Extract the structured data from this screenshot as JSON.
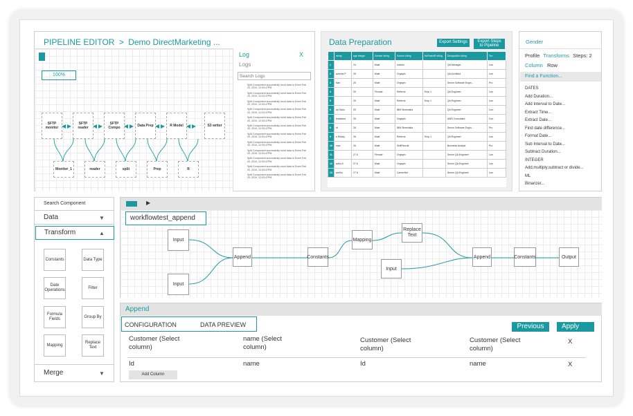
{
  "pipeline_editor": {
    "breadcrumb_root": "PIPELINE EDITOR",
    "breadcrumb_sep": ">",
    "breadcrumb_current": "Demo DirectMarketing ...",
    "zoom": "100%",
    "nodes_top": [
      "SFTP monitor",
      "SFTP reader",
      "SFTP Compo",
      "Data Prep",
      "R Model",
      "S3 writer"
    ],
    "nodes_bottom": [
      "Monitor_1",
      "reader",
      "split",
      "Prep",
      "R"
    ]
  },
  "log": {
    "title": "Log",
    "close": "X",
    "subtitle": "Logs",
    "search_placeholder": "Search Logs",
    "lines": [
      "Split Component successfully send data to Event Feb 20, 2019, 12:03:47PM",
      "Split Component successfully send data to Event Feb 20, 2019, 12:03:47PM",
      "Split Component successfully send data to Event Feb 20, 2019, 12:03:47PM",
      "Split Component successfully send data to Event Feb 20, 2019, 12:03:47PM",
      "Split Component successfully send data to Event Feb 20, 2019, 12:03:47PM",
      "Split Component successfully send data to Event Feb 20, 2019, 12:03:47PM",
      "Split Component successfully send data to Event Feb 20, 2019, 12:03:47PM",
      "Split Component successfully send data to Event Feb 20, 2019, 12:03:47PM",
      "Split Component successfully send data to Event Feb 20, 2019, 12:03:47PM",
      "Split Component successfully send data to Event Feb 20, 2019, 12:03:47PM",
      "Split Component successfully send data to Event Feb 20, 2019, 12:03:47PM",
      "Split Component successfully send data to Event Feb 20, 2019, 12:03:47PM"
    ]
  },
  "data_prep": {
    "title": "Data Preparation",
    "export_settings": "Export Settings",
    "export_steps": "Export Steps to Pipeline",
    "columns": [
      "",
      "string",
      "age integer",
      "Gender string",
      "Source string",
      "NoRatedR string",
      "Designation string",
      "Tex"
    ],
    "rows": [
      [
        "1",
        "",
        "24",
        "Male",
        "Indeed",
        "",
        "QA Manager",
        "Lan"
      ],
      [
        "2",
        "avenda P",
        "25",
        "Male",
        "Orgsyrix",
        "",
        "QA Architect",
        "Lan"
      ],
      [
        "3",
        "Nari",
        "25",
        "Male",
        "Orgsyrix",
        "",
        "Senior Software Engin...",
        "Pro"
      ],
      [
        "4",
        "",
        "25",
        "Female",
        "Referral",
        "Emp 1",
        "QA Engineer",
        "Lan"
      ],
      [
        "5",
        "",
        "25",
        "Male",
        "Referral",
        "Emp 1",
        "QA Engineer",
        "Lan"
      ],
      [
        "6",
        "an Sahu",
        "25",
        "Male",
        "IBM Simeslabs",
        "",
        "QA Engineer",
        "Con"
      ],
      [
        "7",
        "enastava",
        "25",
        "Male",
        "Orgsyrix",
        "",
        "AWS Consultant",
        "Con"
      ],
      [
        "8",
        "rit",
        "26",
        "Male",
        "IBM Simeslabs",
        "",
        "Senior Software Engin...",
        "Pro"
      ],
      [
        "9",
        "a Reddy",
        "26",
        "Male",
        "Referral",
        "Emp 1",
        "QA Engineer",
        "Lan"
      ],
      [
        "10",
        "mac",
        "26",
        "Male",
        "SkillRecruit",
        "",
        "Business Analyst",
        "Pro"
      ],
      [
        "11",
        "",
        "27.6",
        "Female",
        "Orgsyrix",
        "",
        "Senior QA Engineer",
        "Lan"
      ],
      [
        "12",
        "adhu K",
        "27.6",
        "Male",
        "Orgsyrix",
        "",
        "Senior QA Engineer",
        "Lan"
      ],
      [
        "13",
        "andhu",
        "27.6",
        "Male",
        "CareerNet",
        "",
        "Senior QA Engineer",
        "Lan"
      ]
    ]
  },
  "transform_panel": {
    "title": "Gender",
    "tabs": [
      "Profile",
      "Transforms",
      "Steps: 2"
    ],
    "subtabs": [
      "Column",
      "Row"
    ],
    "find": "Find a Function...",
    "items": [
      "DATES",
      "Add Duration...",
      "Add Interval to Date...",
      "Extract Time...",
      "Extract Date...",
      "Find date difference...",
      "Format Date...",
      "Sub Interval to Date...",
      "Subtract Duration...",
      "INTEGER",
      "Add,multiply,subtract or divide...",
      "ML",
      "Binarizer..."
    ]
  },
  "components": {
    "search": "Search Component",
    "data": "Data",
    "transform": "Transform",
    "items": [
      "Constants",
      "Data Type",
      "Date Operations",
      "Filter",
      "Formula Fields",
      "Group By",
      "Mapping",
      "Replace Text"
    ],
    "merge": "Merge"
  },
  "workflow": {
    "name": "workflowtest_append",
    "nodes": [
      "Input",
      "Input",
      "Append",
      "Constants",
      "Mapping",
      "Replace Text",
      "Input",
      "Append",
      "Constants",
      "Output"
    ]
  },
  "append": {
    "title": "Append",
    "tabs": [
      "CONFIGURATION",
      "DATA PREVIEW"
    ],
    "previous": "Previous",
    "apply": "Apply",
    "cols": [
      {
        "top": "Customer (Select column)",
        "val": "Id"
      },
      {
        "top": "name (Select column)",
        "val": "name"
      },
      {
        "top": "Customer (Select column)",
        "val": "Id"
      },
      {
        "top": "Customer (Select column)",
        "val": "name"
      }
    ],
    "close1": "X",
    "close2": "X",
    "add_column": "Add Column"
  },
  "colors": {
    "accent": "#1a9aa0"
  }
}
